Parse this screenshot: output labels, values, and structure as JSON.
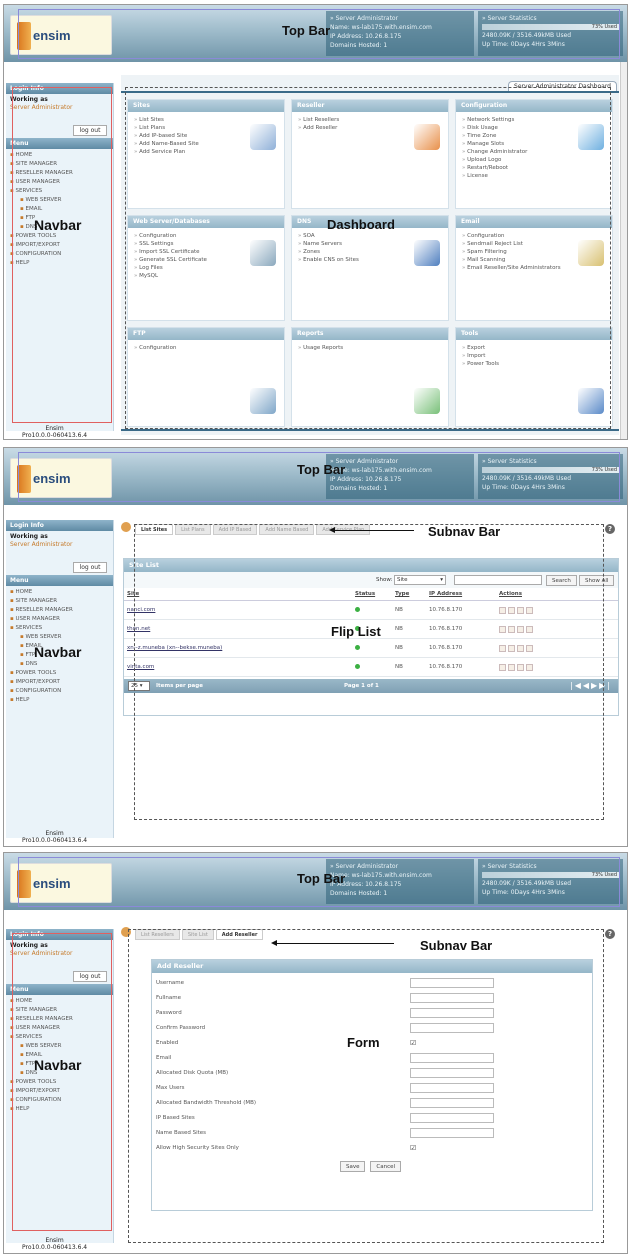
{
  "logo_text": "ensim",
  "topbar": {
    "admin_title": "» Server Administrator",
    "host": "Name: ws-lab175.with.ensim.com",
    "ip": "IP Address: 10.26.8.175",
    "domains": "Domains Hosted: 1",
    "stats_title": "» Server Statistics",
    "stats_used": "73% Used",
    "stats_mem": "2480.09K / 3516.49kMB Used",
    "stats_uptime": "Up Time: 0Days 4Hrs 3Mins"
  },
  "annotations": {
    "top_bar": "Top Bar",
    "navbar": "Navbar",
    "dashboard": "Dashboard",
    "subnav_bar": "Subnav Bar",
    "flip_list": "Flip List",
    "form": "Form"
  },
  "sidebar": {
    "login_header": "Login Info",
    "working_as": "Working as",
    "role": "Server Administrator",
    "logout": "log out",
    "menu_header": "Menu",
    "menu": [
      {
        "label": "HOME",
        "sub": false
      },
      {
        "label": "SITE MANAGER",
        "sub": false
      },
      {
        "label": "RESELLER MANAGER",
        "sub": false
      },
      {
        "label": "USER MANAGER",
        "sub": false
      },
      {
        "label": "SERVICES",
        "sub": false
      },
      {
        "label": "WEB SERVER",
        "sub": true
      },
      {
        "label": "EMAIL",
        "sub": true
      },
      {
        "label": "FTP",
        "sub": true
      },
      {
        "label": "DNS",
        "sub": true
      },
      {
        "label": "POWER TOOLS",
        "sub": false
      },
      {
        "label": "IMPORT/EXPORT",
        "sub": false
      },
      {
        "label": "CONFIGURATION",
        "sub": false
      },
      {
        "label": "HELP",
        "sub": false
      }
    ],
    "version_brand": "Ensim",
    "version": "Pro10.0.0-060413.6.4"
  },
  "dashboard": {
    "tab_label": "Server Administrator Dashboard",
    "tiles": [
      {
        "title": "Sites",
        "items": [
          "List Sites",
          "List Plans",
          "Add IP-based Site",
          "Add Name-Based Site",
          "Add Service Plan"
        ],
        "icon": "sites-icon",
        "color": "#8fb0d8"
      },
      {
        "title": "Reseller",
        "items": [
          "List Resellers",
          "Add Reseller"
        ],
        "icon": "reseller-icon",
        "color": "#e8904a"
      },
      {
        "title": "Configuration",
        "items": [
          "Network Settings",
          "Disk Usage",
          "Time Zone",
          "Manage Slots",
          "Change Administrator",
          "Upload Logo",
          "Restart/Reboot",
          "License"
        ],
        "icon": "configuration-icon",
        "color": "#6fb0e0"
      },
      {
        "title": "Web Server/Databases",
        "items": [
          "Configuration",
          "SSL Settings",
          "Import SSL Certificate",
          "Generate SSL Certificate",
          "Log Files",
          "MySQL"
        ],
        "icon": "database-icon",
        "color": "#8aa8bd"
      },
      {
        "title": "DNS",
        "items": [
          "SOA",
          "Name Servers",
          "Zones",
          "Enable CNS on Sites"
        ],
        "icon": "dns-icon",
        "color": "#4f7fbf"
      },
      {
        "title": "Email",
        "items": [
          "Configuration",
          "Sendmail Reject List",
          "Spam Filtering",
          "Mail Scanning",
          "Email Reseller/Site Administrators"
        ],
        "icon": "email-icon",
        "color": "#d8c070"
      },
      {
        "title": "FTP",
        "items": [
          "Configuration"
        ],
        "icon": "ftp-icon",
        "color": "#7fa6c8"
      },
      {
        "title": "Reports",
        "items": [
          "Usage Reports"
        ],
        "icon": "reports-icon",
        "color": "#79c079"
      },
      {
        "title": "Tools",
        "items": [
          "Export",
          "Import",
          "Power Tools"
        ],
        "icon": "tools-icon",
        "color": "#5a8ac8"
      }
    ]
  },
  "sitelist": {
    "tabs": [
      "List Sites",
      "List Plans",
      "Add IP Based",
      "Add Name Based",
      "Add Service Plan"
    ],
    "panel_title": "Site List",
    "show_label": "Show:",
    "show_value": "Site",
    "search_btn": "Search",
    "show_all_btn": "Show All",
    "columns": [
      "Site",
      "Status",
      "Type",
      "IP Address",
      "Actions"
    ],
    "rows": [
      {
        "site": "nanci.com",
        "type": "NB",
        "ip": "10.76.8.170"
      },
      {
        "site": "thon.net",
        "type": "NB",
        "ip": "10.76.8.170"
      },
      {
        "site": "xn--z.muneba (xn--bekse.muneba)",
        "type": "NB",
        "ip": "10.76.8.170"
      },
      {
        "site": "vinta.com",
        "type": "NB",
        "ip": "10.76.8.170"
      }
    ],
    "per_page_value": "25",
    "per_page_label": "Items per page",
    "page_info": "Page 1 of 1"
  },
  "addreseller": {
    "tabs": [
      "List Resellers",
      "Site List",
      "Add Reseller"
    ],
    "panel_title": "Add Reseller",
    "fields": [
      {
        "label": "Username",
        "type": "text"
      },
      {
        "label": "Fullname",
        "type": "text"
      },
      {
        "label": "Password",
        "type": "text"
      },
      {
        "label": "Confirm Password",
        "type": "text"
      },
      {
        "label": "Enabled",
        "type": "check"
      },
      {
        "label": "Email",
        "type": "text"
      },
      {
        "label": "Allocated Disk Quota (MB)",
        "type": "text"
      },
      {
        "label": "Max Users",
        "type": "text"
      },
      {
        "label": "Allocated Bandwidth Threshold (MB)",
        "type": "text"
      },
      {
        "label": "IP Based Sites",
        "type": "text"
      },
      {
        "label": "Name Based Sites",
        "type": "text"
      },
      {
        "label": "Allow High Security Sites Only",
        "type": "check"
      }
    ],
    "save": "Save",
    "cancel": "Cancel"
  }
}
